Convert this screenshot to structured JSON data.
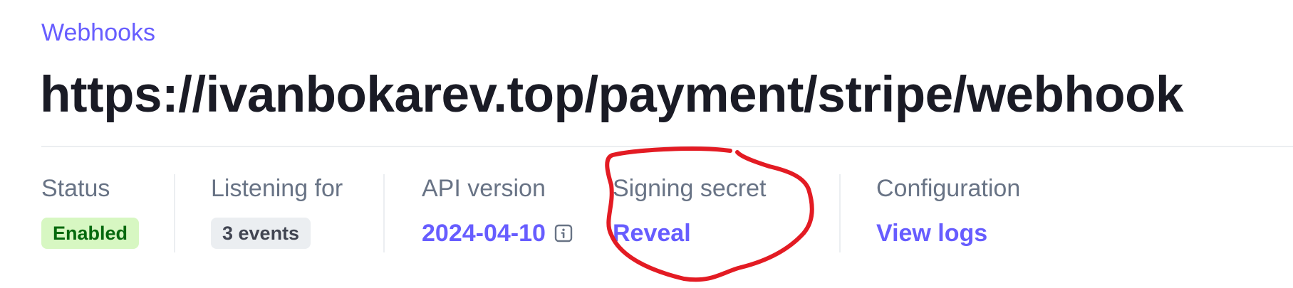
{
  "breadcrumb": {
    "label": "Webhooks"
  },
  "endpoint": {
    "url": "https://ivanbokarev.top/payment/stripe/webhook"
  },
  "details": {
    "status": {
      "label": "Status",
      "value": "Enabled"
    },
    "listening": {
      "label": "Listening for",
      "value": "3 events"
    },
    "api_version": {
      "label": "API version",
      "value": "2024-04-10",
      "icon": "info-icon"
    },
    "signing_secret": {
      "label": "Signing secret",
      "action": "Reveal"
    },
    "configuration": {
      "label": "Configuration",
      "action": "View logs"
    }
  },
  "annotation": {
    "shape": "hand-drawn-circle",
    "color": "#e31b23",
    "target": "signing_secret"
  },
  "colors": {
    "accent": "#675dff",
    "enabled_bg": "#d7f7c2",
    "enabled_text": "#05690d",
    "muted_text": "#687385",
    "title_text": "#1a1b25"
  }
}
